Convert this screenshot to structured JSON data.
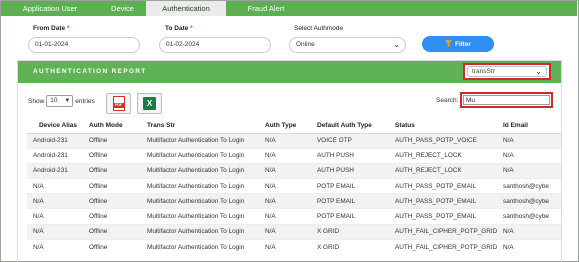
{
  "tabs": [
    {
      "label": "Application User",
      "active": false
    },
    {
      "label": "Device",
      "active": false
    },
    {
      "label": "Authentication",
      "active": true
    },
    {
      "label": "Fraud Alert",
      "active": false
    }
  ],
  "filters": {
    "from_date_label": "From Date",
    "from_date_value": "01-01-2024",
    "to_date_label": "To Date",
    "to_date_value": "01-02-2024",
    "required_mark": "*",
    "authmode_label": "Select Authmode",
    "authmode_value": "Online",
    "filter_button": "Filter"
  },
  "report": {
    "title": "AUTHENTICATION REPORT",
    "column_select_value": "transStr",
    "show_label": "Show",
    "entries_value": "10",
    "entries_label": "entries",
    "search_label": "Search:",
    "search_value": "Mu",
    "columns": [
      "Device Alias",
      "Auth Mode",
      "Trans Str",
      "Auth Type",
      "Default Auth Type",
      "Status",
      "Id Email"
    ],
    "rows": [
      [
        "Android-231",
        "Offline",
        "Multifactor Authentication To Login",
        "N/A",
        "VOICE OTP",
        "AUTH_PASS_POTP_VOICE",
        "N/A"
      ],
      [
        "Android-231",
        "Offline",
        "Multifactor Authentication To Login",
        "N/A",
        "AUTH PUSH",
        "AUTH_REJECT_LOCK",
        "N/A"
      ],
      [
        "Android-231",
        "Offline",
        "Multifactor Authentication To Login",
        "N/A",
        "AUTH PUSH",
        "AUTH_REJECT_LOCK",
        "N/A"
      ],
      [
        "N/A",
        "Offline",
        "Multifactor Authentication To Login",
        "N/A",
        "POTP EMAIL",
        "AUTH_PASS_POTP_EMAIL",
        "santhosh@cybe"
      ],
      [
        "N/A",
        "Offline",
        "Multifactor Authentication To Login",
        "N/A",
        "POTP EMAIL",
        "AUTH_PASS_POTP_EMAIL",
        "santhosh@cybe"
      ],
      [
        "N/A",
        "Offline",
        "Multifactor Authentication To Login",
        "N/A",
        "POTP EMAIL",
        "AUTH_PASS_POTP_EMAIL",
        "santhosh@cybe"
      ],
      [
        "N/A",
        "Offline",
        "Multifactor Authentication To Login",
        "N/A",
        "X GRID",
        "AUTH_FAIL_CIPHER_POTP_GRID",
        "N/A"
      ],
      [
        "N/A",
        "Offline",
        "Multifactor Authentication To Login",
        "N/A",
        "X GRID",
        "AUTH_FAIL_CIPHER_POTP_GRID",
        "N/A"
      ]
    ]
  },
  "icons": {
    "pdf": "pdf-export-icon",
    "excel": "excel-export-icon",
    "pdf_glyph": "PDF",
    "excel_glyph": "X"
  }
}
